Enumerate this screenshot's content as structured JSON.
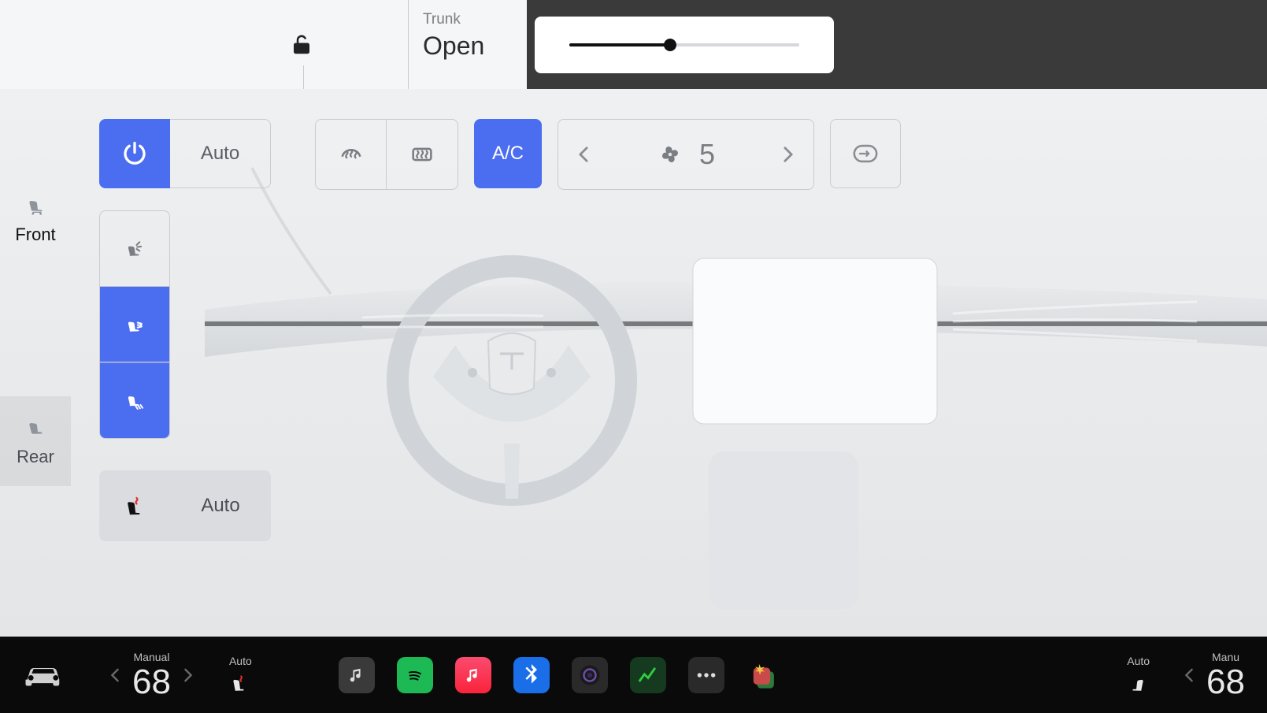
{
  "header": {
    "trunk_label": "Trunk",
    "trunk_status": "Open",
    "slider_pct": 44
  },
  "side_rail": {
    "front_label": "Front",
    "rear_label": "Rear"
  },
  "controls": {
    "auto_label": "Auto",
    "ac_label": "A/C",
    "fan_speed": "5",
    "seat_auto_label": "Auto"
  },
  "footer": {
    "left_temp_mode": "Manual",
    "left_temp": "68",
    "left_seat_mode": "Auto",
    "right_seat_mode": "Auto",
    "right_temp_mode": "Manu",
    "right_temp": "68"
  },
  "colors": {
    "accent": "#4b6df0"
  }
}
